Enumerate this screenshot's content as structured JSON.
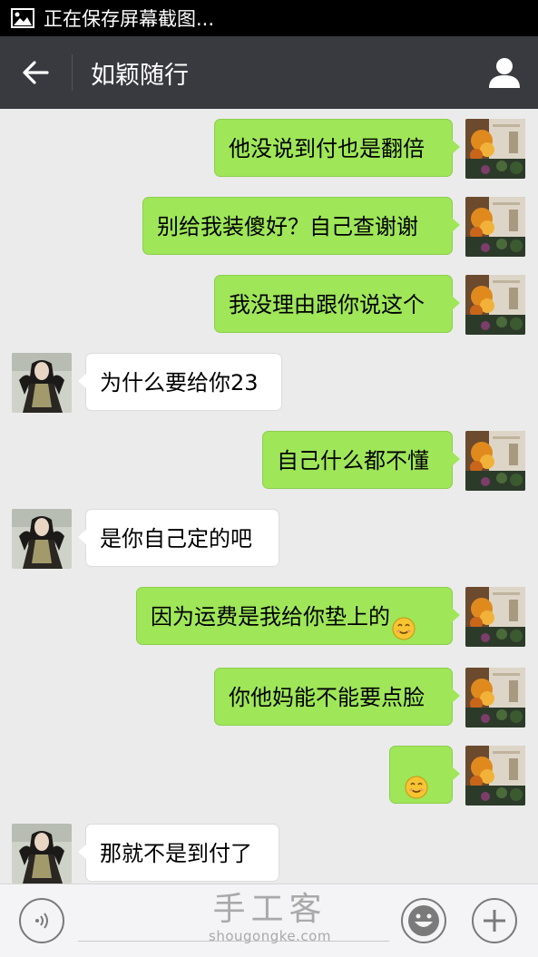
{
  "status_bar": {
    "notification": "正在保存屏幕截图..."
  },
  "header": {
    "title": "如颖随行"
  },
  "messages": [
    {
      "side": "out",
      "text": "他没说到付也是翻倍"
    },
    {
      "side": "out",
      "text": "别给我装傻好？自己查谢谢"
    },
    {
      "side": "out",
      "text": "我没理由跟你说这个"
    },
    {
      "side": "in",
      "text": "为什么要给你23"
    },
    {
      "side": "out",
      "text": "自己什么都不懂"
    },
    {
      "side": "in",
      "text": "是你自己定的吧"
    },
    {
      "side": "out",
      "text": "因为运费是我给你垫上的",
      "emoji": "smile-emoji"
    },
    {
      "side": "out",
      "text": "你他妈能不能要点脸"
    },
    {
      "side": "out",
      "text": "",
      "emoji": "smile-emoji"
    },
    {
      "side": "in",
      "text": "那就不是到付了"
    }
  ],
  "watermark": {
    "main": "手工客",
    "sub": "shougongke.com"
  },
  "colors": {
    "outgoing_bubble": "#9fe658",
    "incoming_bubble": "#ffffff",
    "titlebar": "#393a3f"
  }
}
